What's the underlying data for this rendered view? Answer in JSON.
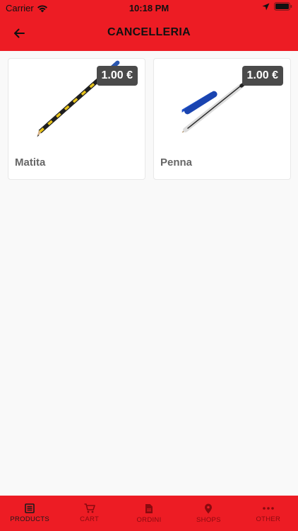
{
  "status_bar": {
    "carrier": "Carrier",
    "time": "10:18 PM"
  },
  "nav": {
    "title": "CANCELLERIA"
  },
  "products": [
    {
      "name": "Matita",
      "price": "1.00 €"
    },
    {
      "name": "Penna",
      "price": "1.00 €"
    }
  ],
  "tabs": [
    {
      "label": "PRODUCTS",
      "active": true
    },
    {
      "label": "CART",
      "active": false
    },
    {
      "label": "ORDINI",
      "active": false
    },
    {
      "label": "SHOPS",
      "active": false
    },
    {
      "label": "OTHER",
      "active": false
    }
  ],
  "colors": {
    "brand": "#ed1c24",
    "price_badge": "#4a4a4a",
    "tab_inactive": "#8a0a0f"
  }
}
